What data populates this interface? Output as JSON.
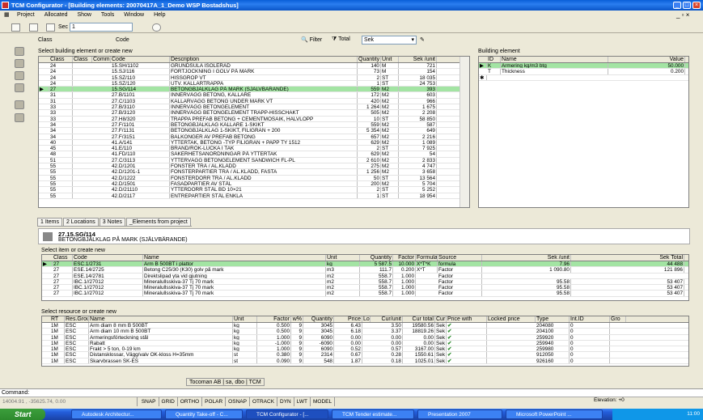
{
  "app": {
    "title": "TCM Configurator - [Building elements: 20070417A_1_Demo WSP Bostadshus]",
    "menu": [
      "Project",
      "Allocated",
      "Show",
      "Tools",
      "Window",
      "Help"
    ],
    "toolbar": {
      "sec_label": "Sec",
      "sec_value": "1"
    }
  },
  "filter": {
    "class_label": "Class",
    "code_label": "Code",
    "filter_label": "Filter",
    "total_label": "Total",
    "unit_select": "Sek"
  },
  "building_grid": {
    "caption": "Select building element or create new",
    "headers": [
      "Class",
      "Class",
      "Comm",
      "Code",
      "Description",
      "Quantity",
      "Unit",
      "Sek /unit"
    ],
    "rows": [
      [
        "24",
        "",
        "",
        "15.SH/1102",
        "GRUNDSULA ISOLERAD",
        "140",
        "M",
        "721"
      ],
      [
        "24",
        "",
        "",
        "15.SJ/116",
        "FÖRTJOCKNING I GOLV PÅ MARK",
        "73",
        "M",
        "154"
      ],
      [
        "24",
        "",
        "",
        "15.SZ/110",
        "HISSGROP VT",
        "2",
        "ST",
        "18 035"
      ],
      [
        "24",
        "",
        "",
        "15.SZ/120",
        "UTV. KALLARTRAPPA",
        "1",
        "ST",
        "24 753"
      ],
      [
        "27",
        "",
        "",
        "15.SG/114",
        "BETONGBJÄLKLAG PÅ MARK (SJÄLVBÄRANDE)",
        "559",
        "M2",
        "393"
      ],
      [
        "31",
        "",
        "",
        "27.B/1101",
        "INNERVÄGG BETONG, KÄLLARE",
        "172",
        "M2",
        "603"
      ],
      [
        "31",
        "",
        "",
        "27.C/1103",
        "KALLARVÄGG BETONG UNDER MARK VT",
        "420",
        "M2",
        "966"
      ],
      [
        "33",
        "",
        "",
        "27.B/3110",
        "INNERVÄGG BETONGELEMENT",
        "1 264",
        "M2",
        "1 675"
      ],
      [
        "33",
        "",
        "",
        "27.B/3120",
        "INNERVÄGG BETONGELEMENT TRAPP-HISSCHAKT",
        "505",
        "M2",
        "2 208"
      ],
      [
        "33",
        "",
        "",
        "27.H8/320",
        "TRAPPA PREFAB BETONG + CEMENTMOSAIK, HALVLOPP",
        "10",
        "ST",
        "58 850"
      ],
      [
        "34",
        "",
        "",
        "27.F/1101",
        "BETONGBJÄLKLAG KÄLLARE 1-SKIKT",
        "559",
        "M2",
        "587"
      ],
      [
        "34",
        "",
        "",
        "27.F/1131",
        "BETONGBJÄLKLAG 1-SKIKT, FILIGRAN + 200",
        "5 354",
        "M2",
        "649"
      ],
      [
        "34",
        "",
        "",
        "27.F/3151",
        "BALKONGER AV PREFAB BETONG",
        "657",
        "M2",
        "2 216"
      ],
      [
        "40",
        "",
        "",
        "41.A/141",
        "YTTERTAK, BETONG -TYP FILIGRAN + PAPP TY 1512",
        "629",
        "M2",
        "1 089"
      ],
      [
        "45",
        "",
        "",
        "41.E/110",
        "BRAND/RÖK-LUCKA I TAK",
        "2",
        "ST",
        "7 925"
      ],
      [
        "48",
        "",
        "",
        "41.FD/110",
        "SÄKERHETSANORDNINGAR PÅ YTTERTAK",
        "629",
        "M2",
        "54"
      ],
      [
        "51",
        "",
        "",
        "27.C/3113",
        "YTTERVÄGG BETONGELEMENT SANDWICH FL-PL",
        "2 610",
        "M2",
        "2 833"
      ],
      [
        "55",
        "",
        "",
        "42.D/1201",
        "FÖNSTER TRÄ / AL.KLÄDD",
        "275",
        "M2",
        "4 747"
      ],
      [
        "55",
        "",
        "",
        "42.D/1201-1",
        "FÖNSTERPARTIER TRÄ / AL.KLÄDD, FASTA",
        "1 256",
        "M2",
        "3 658"
      ],
      [
        "55",
        "",
        "",
        "42.D/1222",
        "FÖNSTERDÖRR TRÄ / AL.KLÄDD",
        "50",
        "ST",
        "13 564"
      ],
      [
        "55",
        "",
        "",
        "42.D/1501",
        "FASADPARTIER AV STÅL",
        "200",
        "M2",
        "5 704"
      ],
      [
        "55",
        "",
        "",
        "42.D/21110",
        "YTTERDÖRR STÅL BD 10×21",
        "2",
        "ST",
        "5 252"
      ],
      [
        "55",
        "",
        "",
        "42.D/2117",
        "ENTREPARTIER STÅL ENKLA",
        "1",
        "ST",
        "18 954"
      ]
    ]
  },
  "building_element": {
    "caption": "Building element",
    "headers": [
      "ID",
      "Name",
      "Value"
    ],
    "rows": [
      [
        "K",
        "Armering kg/m3 btg",
        "50.000"
      ],
      [
        "T",
        "Thickness",
        "0.200"
      ]
    ]
  },
  "tabs": [
    "1 Items",
    "2 Locations",
    "3 Notes",
    "_Elements from project"
  ],
  "element_header": {
    "code": "27.15.SG/114",
    "name": "BETONGBJÄLKLAG PÅ MARK (SJÄLVBÄRANDE)"
  },
  "items_grid": {
    "caption": "Select item or create new",
    "headers": [
      "Class",
      "Code",
      "Name",
      "Unit",
      "Quantity",
      "Factor",
      "Formula",
      "Source",
      "Sek /unit",
      "Sek Total"
    ],
    "rows": [
      [
        "27",
        "ESC.1/2731",
        "Arm B 500BT i plattor",
        "kg",
        "5 587.5",
        "10.000",
        "X*T*K",
        "formula",
        "7.96",
        "44 488"
      ],
      [
        "27",
        "ESE.14/2725",
        "Betong C25/30 (K30) golv på mark",
        "m3",
        "111.7",
        "0.200",
        "X*T",
        "Factor",
        "1 090.80",
        "121 896"
      ],
      [
        "27",
        "ESE.14/2781",
        "Direktslipad yta vid gjutning",
        "m2",
        "558.7",
        "1.000",
        "",
        "Factor",
        "",
        ""
      ],
      [
        "27",
        "IBC.1//27012",
        "Mineralullsskiva-37 Tj 70 mark",
        "m2",
        "558.7",
        "1.000",
        "",
        "Factor",
        "95.58",
        "53 407"
      ],
      [
        "27",
        "IBC.1//27012",
        "Mineralullsskiva-37 Tj 70 mark",
        "m2",
        "558.7",
        "1.000",
        "",
        "Factor",
        "95.58",
        "53 407"
      ],
      [
        "27",
        "IBC.1//27012",
        "Mineralullsskiva-37 Tj 70 mark",
        "m2",
        "558.7",
        "1.000",
        "",
        "Factor",
        "95.58",
        "53 407"
      ]
    ]
  },
  "resource_grid": {
    "caption": "Select resource or create new",
    "headers": [
      "RT",
      "Res.Group",
      "Name",
      "Unit",
      "Factor",
      "w%",
      "Quantity",
      "Price",
      "Lo",
      "Cur/unit",
      "Cur total",
      "Cur",
      "Price with",
      "Locked price",
      "Type",
      "Int.ID",
      "Gro"
    ],
    "rows": [
      [
        "1M",
        "ESC",
        "Arm diam 8 mm B 500BT",
        "kg",
        "0.500",
        "9",
        "3045",
        "6.43",
        "",
        "3.50",
        "19580.56",
        "Sek",
        "",
        "",
        "204080",
        "0",
        ""
      ],
      [
        "1M",
        "ESC",
        "Arm diam 10 mm B 500BT",
        "kg",
        "0.500",
        "9",
        "3045",
        "6.18",
        "",
        "3.37",
        "18819.26",
        "Sek",
        "",
        "",
        "204100",
        "0",
        ""
      ],
      [
        "1M",
        "ESC",
        "Armeringsförteckning stål",
        "kg",
        "1.000",
        "9",
        "6090",
        "0.00",
        "",
        "0.00",
        "0.00",
        "Sek",
        "",
        "",
        "259920",
        "0",
        ""
      ],
      [
        "1M",
        "ESC",
        "Rabatt",
        "kg",
        "-1.000",
        "9",
        "-6090",
        "0.00",
        "",
        "0.00",
        "0.00",
        "Sek",
        "",
        "",
        "259940",
        "0",
        ""
      ],
      [
        "1M",
        "ESC",
        "Frakt > 5 ton, 0-19 km",
        "kg",
        "1.000",
        "9",
        "6090",
        "0.52",
        "",
        "0.57",
        "3167.00",
        "Sek",
        "",
        "",
        "259980",
        "0",
        ""
      ],
      [
        "1M",
        "ESC",
        "Distansklossar, Vägg/valv OK-kloss H=35mm",
        "st",
        "0.380",
        "9",
        "2314",
        "0.67",
        "",
        "0.28",
        "1550.61",
        "Sek",
        "",
        "",
        "912050",
        "0",
        ""
      ],
      [
        "1M",
        "ESC",
        "Skarvbrassen SK-ES",
        "st",
        "0.090",
        "9",
        "548",
        "1.87",
        "",
        "0.18",
        "1025.01",
        "Sek",
        "",
        "",
        "926160",
        "0",
        ""
      ]
    ]
  },
  "footer": {
    "company": "Tocoman AB",
    "user": "sa, dbo",
    "app": "TCM"
  },
  "command": {
    "label": "Command:"
  },
  "status": {
    "coords": "14004.91 , -35625.74, 0.00",
    "toggles": [
      "SNAP",
      "GRID",
      "ORTHO",
      "POLAR",
      "OSNAP",
      "OTRACK",
      "DYN",
      "LWT",
      "MODEL"
    ],
    "elevation": "Elevation: +0"
  },
  "taskbar": {
    "start": "Start",
    "tasks": [
      "Autodesk Architectur...",
      "Quantity Take-off - C...",
      "TCM Configurator - [...",
      "TCM Tender estimate...",
      "Presentation 2007",
      "Microsoft PowerPoint ..."
    ],
    "clock": "11:00"
  }
}
